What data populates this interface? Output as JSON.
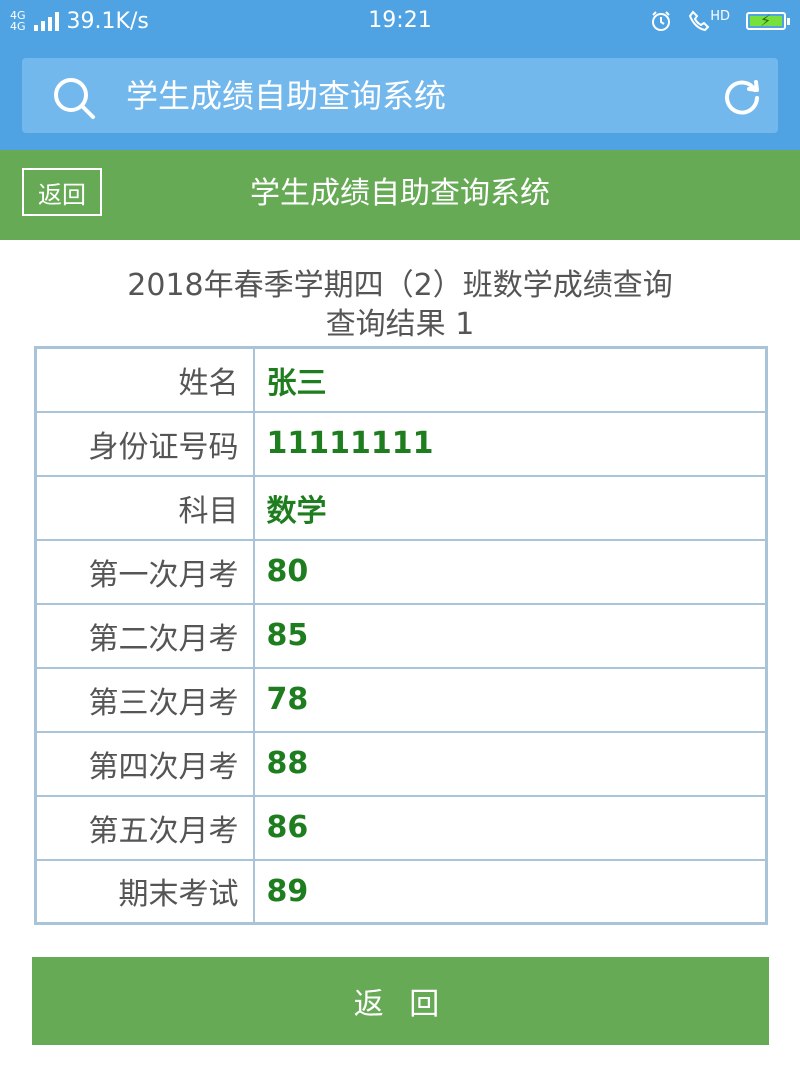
{
  "status_bar": {
    "net_type_top": "4G",
    "net_type_bottom": "4G",
    "speed": "39.1K/s",
    "time": "19:21",
    "hd_label": "HD"
  },
  "search": {
    "placeholder": "学生成绩自助查询系统"
  },
  "title_bar": {
    "back_label": "返回",
    "title": "学生成绩自助查询系统"
  },
  "heading": {
    "title": "2018年春季学期四（2）班数学成绩查询",
    "subtitle": "查询结果 1"
  },
  "results": {
    "rows": [
      {
        "label": "姓名",
        "value": "张三"
      },
      {
        "label": "身份证号码",
        "value": "11111111"
      },
      {
        "label": "科目",
        "value": "数学"
      },
      {
        "label": "第一次月考",
        "value": "80"
      },
      {
        "label": "第二次月考",
        "value": "85"
      },
      {
        "label": "第三次月考",
        "value": "78"
      },
      {
        "label": "第四次月考",
        "value": "88"
      },
      {
        "label": "第五次月考",
        "value": "86"
      },
      {
        "label": "期末考试",
        "value": "89"
      }
    ]
  },
  "footer": {
    "back_label": "返 回"
  },
  "colors": {
    "header_blue": "#4fa3e3",
    "title_green": "#66aa55",
    "value_green": "#1e7d1e"
  }
}
